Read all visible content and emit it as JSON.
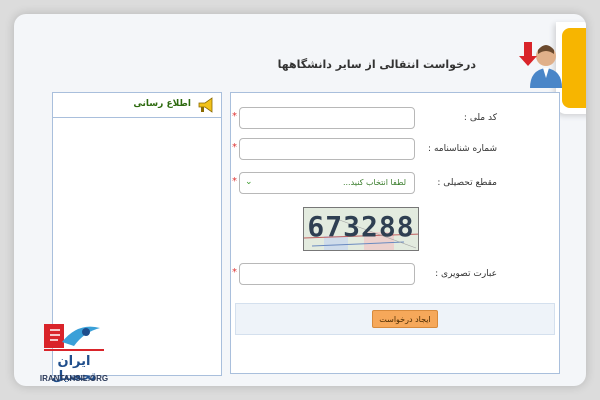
{
  "page": {
    "title": "درخواست انتقالی از سایر دانشگاهها"
  },
  "sidebar": {
    "title": "اطلاع رسانی",
    "icon": "megaphone-icon"
  },
  "form": {
    "fields": [
      {
        "label": "کد ملی :",
        "value": "",
        "required": "*"
      },
      {
        "label": "شماره شناسنامه :",
        "value": "",
        "required": "*"
      },
      {
        "label": "مقطع تحصیلی :",
        "selected": "لطفا انتخاب کنید...",
        "required": "*"
      }
    ],
    "captcha": {
      "text": "673288"
    },
    "captcha_field": {
      "label": "عبارت تصویری :",
      "value": "",
      "required": "*"
    },
    "submit_label": "ایجاد درخواست"
  },
  "logo": {
    "wordmark": "ایران تحصیل",
    "site": "IRANTAHSIL.ORG"
  },
  "colors": {
    "accent_orange": "#f6a85a",
    "panel_border": "#a9bfdc",
    "required": "#dd3333",
    "badge": "#f7b500"
  }
}
